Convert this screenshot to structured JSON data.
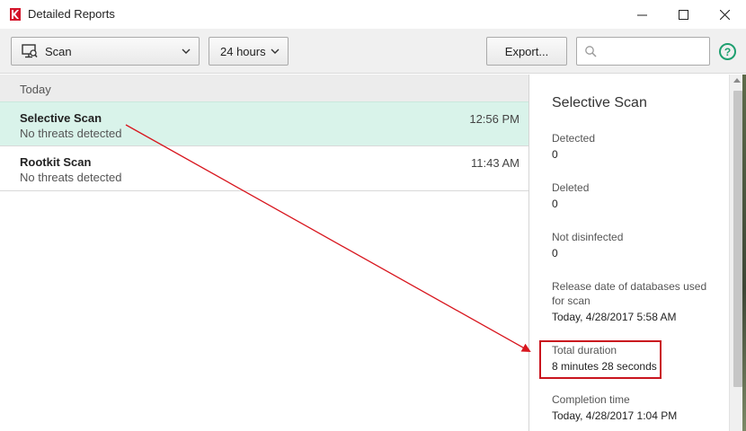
{
  "window": {
    "title": "Detailed Reports",
    "logo_icon": "kaspersky-k-icon",
    "min_icon": "—",
    "max_icon": "☐",
    "close_icon": "✕"
  },
  "toolbar": {
    "scan_dropdown": {
      "label": "Scan",
      "icon": "monitor-scan-icon"
    },
    "period_dropdown": {
      "label": "24 hours"
    },
    "export_label": "Export...",
    "search": {
      "value": "",
      "placeholder": ""
    },
    "help_icon": "?"
  },
  "report_list": {
    "group": "Today",
    "items": [
      {
        "name": "Selective Scan",
        "status": "No threats detected",
        "time": "12:56 PM",
        "selected": true
      },
      {
        "name": "Rootkit Scan",
        "status": "No threats detected",
        "time": "11:43 AM",
        "selected": false
      }
    ]
  },
  "details": {
    "title": "Selective Scan",
    "fields": [
      {
        "label": "Detected",
        "value": "0"
      },
      {
        "label": "Deleted",
        "value": "0"
      },
      {
        "label": "Not disinfected",
        "value": "0"
      },
      {
        "label": "Release date of databases used for scan",
        "value": "Today, 4/28/2017 5:58 AM"
      },
      {
        "label": "Total duration",
        "value": "8 minutes 28 seconds"
      },
      {
        "label": "Completion time",
        "value": "Today, 4/28/2017 1:04 PM"
      }
    ]
  },
  "colors": {
    "accent_green": "#1d9f6f",
    "selected_row": "#d9f3ea",
    "annotation_red": "#c9141e"
  }
}
